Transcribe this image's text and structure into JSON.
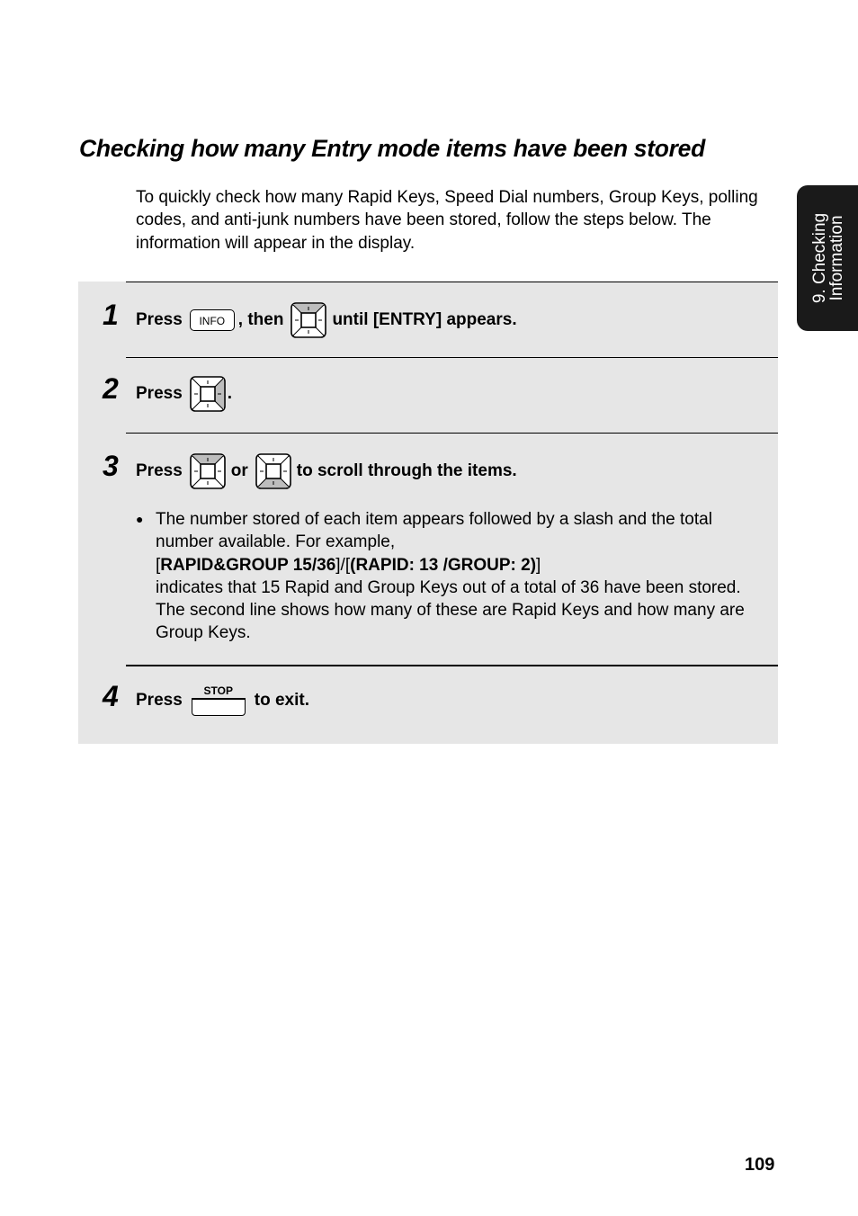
{
  "page": {
    "title": "Checking how many Entry mode items have been stored",
    "intro": "To quickly check how many Rapid Keys, Speed Dial numbers, Group Keys, polling codes, and anti-junk numbers have been stored, follow the steps below. The information will appear in the display.",
    "side_tab": {
      "line1": "9. Checking",
      "line2": "Information"
    },
    "page_number": "109"
  },
  "steps": [
    {
      "number": "1",
      "press": "Press",
      "key_label": "INFO",
      "then": ", then",
      "nav_icon": "nav-key-up-icon",
      "rest": "until [ENTRY] appears."
    },
    {
      "number": "2",
      "press": "Press",
      "nav_icon": "nav-key-right-icon",
      "rest": "."
    },
    {
      "number": "3",
      "press": "Press",
      "nav_icon_1": "nav-key-up-icon",
      "or": "or",
      "nav_icon_2": "nav-key-down-icon",
      "rest": "to scroll through the items.",
      "bullet": {
        "line1": "The number stored of each item appears followed by a slash and the total number available. For example,",
        "example_open": "[",
        "example_bold1": "RAPID&GROUP 15/36",
        "example_mid": "]/[",
        "example_bold2": "(RAPID: 13 /GROUP: 2)",
        "example_close": "]",
        "line2": "indicates that 15 Rapid and Group Keys out of a total of 36 have been stored. The second line shows how many of these are Rapid Keys and how many are Group Keys."
      }
    },
    {
      "number": "4",
      "press": "Press",
      "key_label": "STOP",
      "rest": "to exit."
    }
  ]
}
